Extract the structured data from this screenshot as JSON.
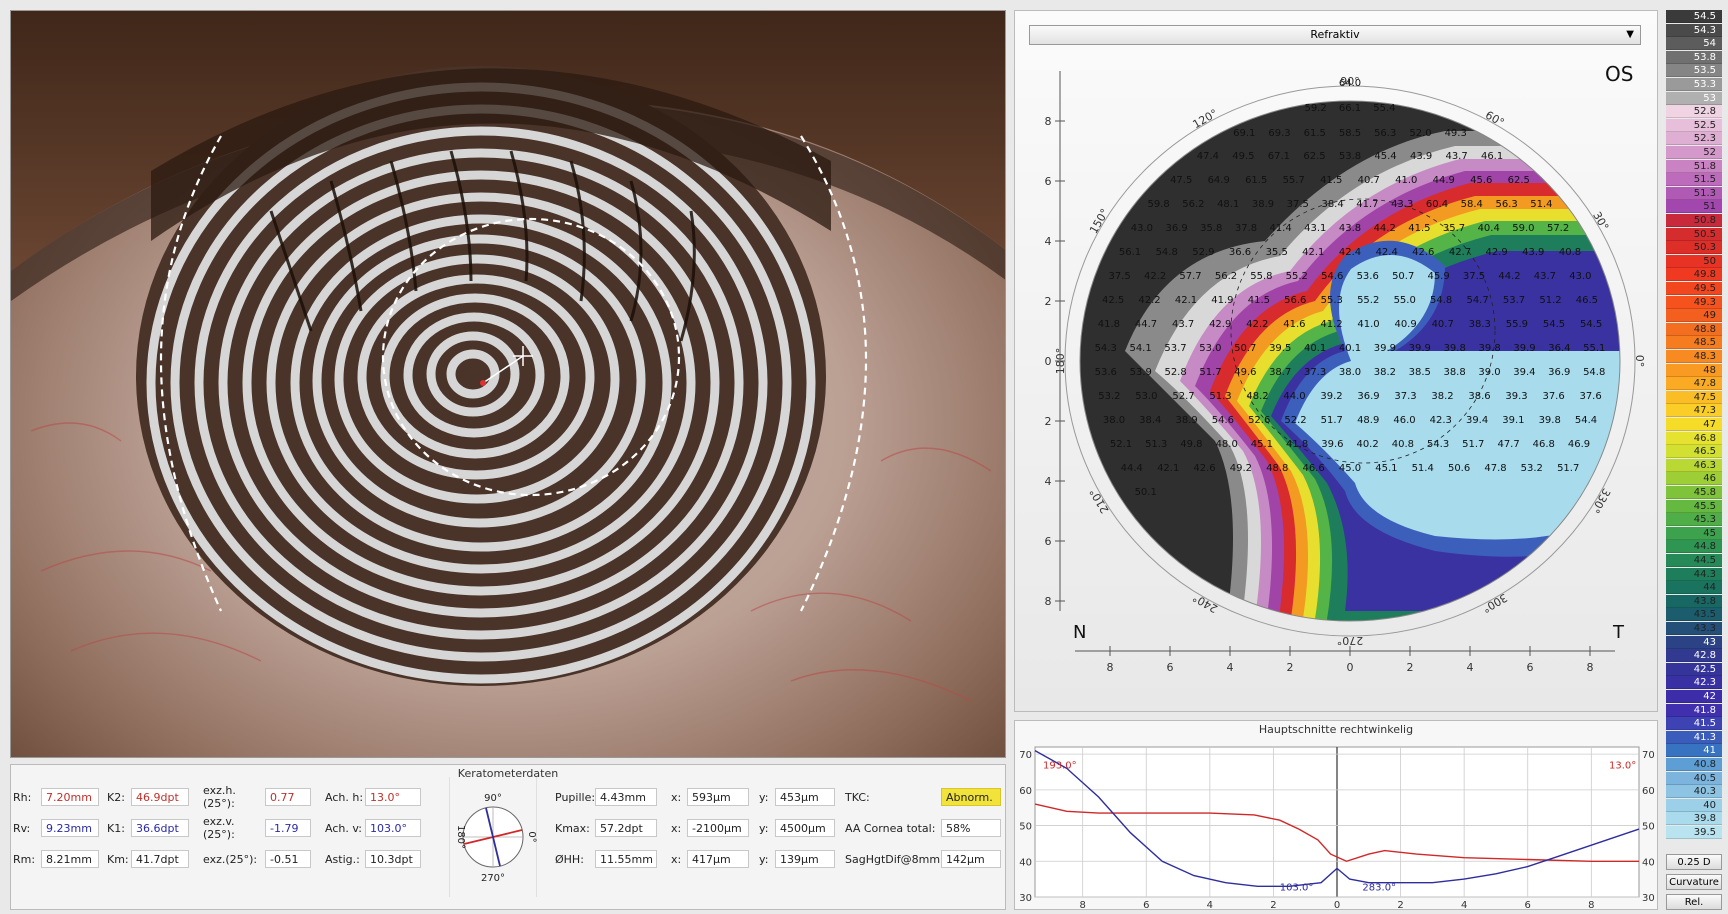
{
  "map": {
    "selector": "Refraktiv",
    "eye": "OS",
    "nasal": "N",
    "temporal": "T",
    "angles": [
      "90°",
      "60°",
      "30°",
      "0°",
      "330°",
      "300°",
      "270°",
      "240°",
      "210°",
      "180°",
      "150°",
      "120°"
    ],
    "x_ticks": [
      "8",
      "6",
      "4",
      "2",
      "0",
      "2",
      "4",
      "6",
      "8"
    ],
    "y_ticks": [
      "8",
      "6",
      "4",
      "2",
      "0",
      "2",
      "4",
      "6",
      "8"
    ],
    "cell_values": [
      "64.0",
      "59.2",
      "66.1",
      "55.4",
      "69.1",
      "69.3",
      "61.5",
      "58.5",
      "56.3",
      "52.0",
      "49.3",
      "47.4",
      "49.5",
      "67.1",
      "62.5",
      "53.8",
      "45.4",
      "43.9",
      "43.7",
      "46.1",
      "47.5",
      "64.9",
      "61.5",
      "55.7",
      "41.5",
      "40.7",
      "41.0",
      "44.9",
      "45.6",
      "62.5",
      "59.8",
      "56.2",
      "48.1",
      "38.9",
      "37.5",
      "38.4",
      "41.7",
      "43.3",
      "60.4",
      "58.4",
      "56.3",
      "51.4",
      "43.0",
      "36.9",
      "35.8",
      "37.8",
      "41.4",
      "43.1",
      "43.8",
      "44.2",
      "41.5",
      "35.7",
      "40.4",
      "59.0",
      "57.2",
      "56.1",
      "54.8",
      "52.9",
      "36.6",
      "35.5",
      "42.1",
      "42.4",
      "42.4",
      "42.6",
      "42.7",
      "42.9",
      "43.9",
      "40.8",
      "37.5",
      "42.2",
      "57.7",
      "56.2",
      "55.8",
      "55.2",
      "54.6",
      "53.6",
      "50.7",
      "45.9",
      "37.5",
      "44.2",
      "43.7",
      "43.0",
      "42.5",
      "42.2",
      "42.1",
      "41.9",
      "41.5",
      "56.6",
      "55.3",
      "55.2",
      "55.0",
      "54.8",
      "54.7",
      "53.7",
      "51.2",
      "46.5",
      "41.8",
      "44.7",
      "43.7",
      "42.9",
      "42.2",
      "41.6",
      "41.2",
      "41.0",
      "40.9",
      "40.7",
      "38.3",
      "55.9",
      "54.5",
      "54.5",
      "54.3",
      "54.1",
      "53.7",
      "53.0",
      "50.7",
      "39.5",
      "40.1",
      "40.1",
      "39.9",
      "39.9",
      "39.8",
      "39.8",
      "39.9",
      "36.4",
      "55.1",
      "53.6",
      "53.9",
      "52.8",
      "51.7",
      "49.6",
      "38.7",
      "37.3",
      "38.0",
      "38.2",
      "38.5",
      "38.8",
      "39.0",
      "39.4",
      "36.9",
      "54.8",
      "53.2",
      "53.0",
      "52.7",
      "51.3",
      "48.2",
      "44.0",
      "39.2",
      "36.9",
      "37.3",
      "38.2",
      "38.6",
      "39.3",
      "37.6",
      "37.6",
      "38.0",
      "38.4",
      "38.9",
      "54.6",
      "52.6",
      "52.2",
      "51.7",
      "48.9",
      "46.0",
      "42.3",
      "39.4",
      "39.1",
      "39.8",
      "54.4",
      "52.1",
      "51.3",
      "49.8",
      "48.0",
      "45.1",
      "41.8",
      "39.6",
      "40.2",
      "40.8",
      "54.3",
      "51.7",
      "47.7",
      "46.8",
      "46.9",
      "44.4",
      "42.1",
      "42.6",
      "49.2",
      "48.8",
      "46.6",
      "45.0",
      "45.1",
      "51.4",
      "50.6",
      "47.8",
      "53.2",
      "51.7",
      "50.1"
    ]
  },
  "scale": {
    "values": [
      "54.5",
      "54.3",
      "54",
      "53.8",
      "53.5",
      "53.3",
      "53",
      "52.8",
      "52.5",
      "52.3",
      "52",
      "51.8",
      "51.5",
      "51.3",
      "51",
      "50.8",
      "50.5",
      "50.3",
      "50",
      "49.8",
      "49.5",
      "49.3",
      "49",
      "48.8",
      "48.5",
      "48.3",
      "48",
      "47.8",
      "47.5",
      "47.3",
      "47",
      "46.8",
      "46.5",
      "46.3",
      "46",
      "45.8",
      "45.5",
      "45.3",
      "45",
      "44.8",
      "44.5",
      "44.3",
      "44",
      "43.8",
      "43.5",
      "43.3",
      "43",
      "42.8",
      "42.5",
      "42.3",
      "42",
      "41.8",
      "41.5",
      "41.3",
      "41",
      "40.8",
      "40.5",
      "40.3",
      "40",
      "39.8",
      "39.5"
    ],
    "colors": [
      "#3a3a3a",
      "#4a4a4a",
      "#5c5c5c",
      "#707070",
      "#858585",
      "#9a9a9a",
      "#b0b0b0",
      "#f0d4e4",
      "#e7bfda",
      "#dfaed3",
      "#d498ca",
      "#c982c2",
      "#bd6cbc",
      "#b15ab5",
      "#a247ad",
      "#c82a3c",
      "#d52c2e",
      "#de2e28",
      "#e83224",
      "#ef3a21",
      "#f2461f",
      "#f5521e",
      "#f35f1e",
      "#f46e1f",
      "#f57d20",
      "#f78b21",
      "#f99a22",
      "#fbab23",
      "#fbbd25",
      "#fbce27",
      "#f4dc28",
      "#e6e230",
      "#d2e032",
      "#b9d834",
      "#9dce35",
      "#7fc33b",
      "#66b940",
      "#4fae47",
      "#3ca24d",
      "#2e9652",
      "#258a57",
      "#1e7e5b",
      "#1a735f",
      "#176864",
      "#1b5d6c",
      "#234f78",
      "#2b4284",
      "#313a90",
      "#35349a",
      "#3930a3",
      "#3d2da9",
      "#4030ae",
      "#3e43b4",
      "#3a5cba",
      "#3773c1",
      "#5d9fd4",
      "#7cb4dd",
      "#8dc3e3",
      "#9cd0e8",
      "#a9dbec",
      "#b8e3ef"
    ],
    "btn_step": "0.25 D",
    "btn_curvature": "Curvature",
    "btn_rel": "Rel."
  },
  "kerato": {
    "title": "Keratometerdaten",
    "rh": {
      "label": "Rh:",
      "value": "7.20mm"
    },
    "rv": {
      "label": "Rv:",
      "value": "9.23mm"
    },
    "rm": {
      "label": "Rm:",
      "value": "8.21mm"
    },
    "k2": {
      "label": "K2:",
      "value": "46.9dpt"
    },
    "k1": {
      "label": "K1:",
      "value": "36.6dpt"
    },
    "km": {
      "label": "Km:",
      "value": "41.7dpt"
    },
    "exzh": {
      "label": "exz.h.(25°):",
      "value": "0.77"
    },
    "exzv": {
      "label": "exz.v.(25°):",
      "value": "-1.79"
    },
    "exz": {
      "label": "exz.(25°):",
      "value": "-0.51"
    },
    "achh": {
      "label": "Ach. h:",
      "value": "13.0°"
    },
    "achv": {
      "label": "Ach. v:",
      "value": "103.0°"
    },
    "astig": {
      "label": "Astig.:",
      "value": "10.3dpt"
    },
    "axis_labels": {
      "top": "90°",
      "bottom": "270°",
      "left": "180°",
      "right": "0°"
    },
    "pupille": {
      "label": "Pupille:",
      "value": "4.43mm",
      "x_label": "x:",
      "x": "593µm",
      "y_label": "y:",
      "y": "453µm"
    },
    "kmax": {
      "label": "Kmax:",
      "value": "57.2dpt",
      "x_label": "x:",
      "x": "-2100µm",
      "y_label": "y:",
      "y": "4500µm"
    },
    "ohh": {
      "label": "ØHH:",
      "value": "11.55mm",
      "x_label": "x:",
      "x": "417µm",
      "y_label": "y:",
      "y": "139µm"
    },
    "tkc": {
      "label": "TKC:",
      "value": "Abnorm."
    },
    "aa": {
      "label": "AA Cornea total:",
      "value": "58%"
    },
    "sag": {
      "label": "SagHgtDif@8mm:",
      "value": "142µm"
    }
  },
  "chart_data": {
    "type": "line",
    "title": "Hauptschnitte rechtwinkelig",
    "xlabel": "",
    "ylabel": "",
    "x_tick_labels": [
      "8",
      "6",
      "4",
      "2",
      "0",
      "2",
      "4",
      "6",
      "8"
    ],
    "y_ticks": [
      30,
      40,
      50,
      60,
      70
    ],
    "ylim": [
      30,
      72
    ],
    "xlim": [
      -9.5,
      9.5
    ],
    "labels": {
      "red_left": "193.0°",
      "red_right": "13.0°",
      "blue_left": "103.0°",
      "blue_right": "283.0°"
    },
    "series": [
      {
        "color": "#d02828",
        "x": [
          -9.5,
          -8.5,
          -7.5,
          -6,
          -4,
          -2.6,
          -1.8,
          -1.2,
          -0.6,
          -0.2,
          0.3,
          1,
          1.5,
          2.5,
          4,
          6,
          8,
          9.5
        ],
        "values": [
          56,
          54,
          53.5,
          53.5,
          53.5,
          53,
          51.5,
          49,
          46,
          42,
          40,
          42,
          43,
          42,
          41,
          40.5,
          40,
          40
        ]
      },
      {
        "color": "#2e2e9e",
        "x": [
          -9.5,
          -8.5,
          -7.5,
          -6.5,
          -5.5,
          -4.5,
          -3.5,
          -2.5,
          -1.5,
          -0.5,
          0,
          0.4,
          1,
          2,
          3,
          4,
          5,
          6,
          7,
          8,
          9.5
        ],
        "values": [
          71,
          66,
          58,
          48,
          40,
          36,
          34,
          33,
          33,
          34,
          38,
          35,
          34,
          34,
          34,
          35,
          36.5,
          38.5,
          41.5,
          44.5,
          49
        ]
      }
    ]
  }
}
